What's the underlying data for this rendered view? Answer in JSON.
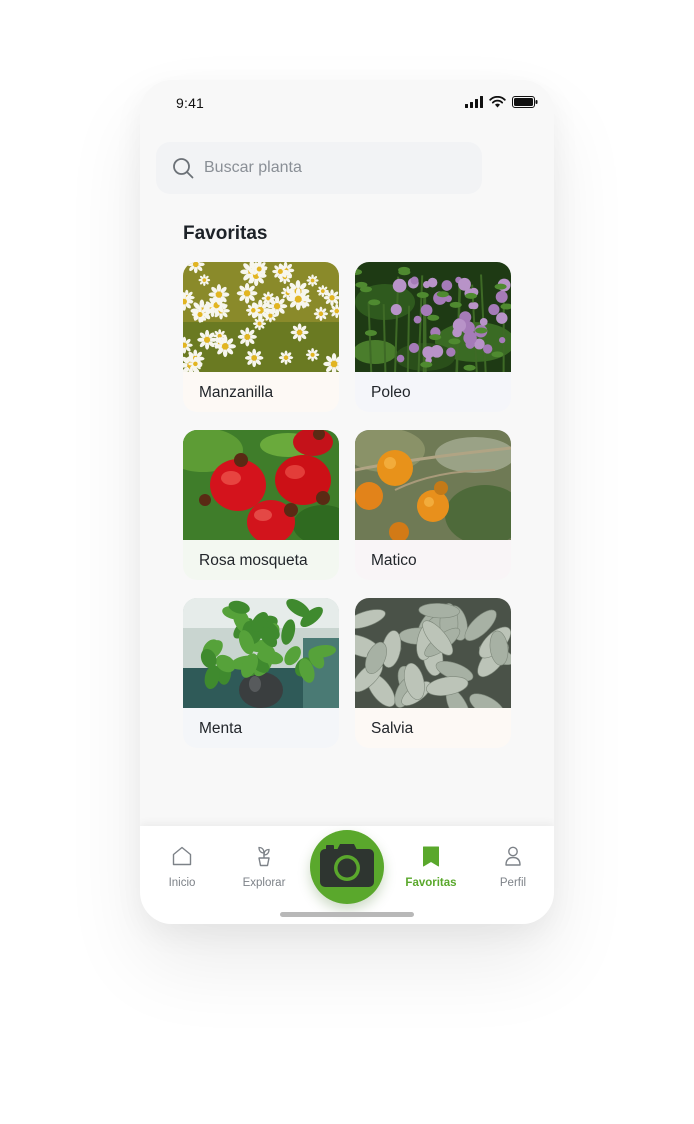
{
  "status_bar": {
    "time": "9:41"
  },
  "search": {
    "placeholder": "Buscar planta",
    "value": ""
  },
  "favorites": {
    "title": "Favoritas",
    "items": [
      {
        "name": "Manzanilla",
        "image": "chamomile-photo",
        "bg": "#fdf9f5"
      },
      {
        "name": "Poleo",
        "image": "pennyroyal-photo",
        "bg": "#f5f6fa"
      },
      {
        "name": "Rosa mosqueta",
        "image": "rosehip-photo",
        "bg": "#f3f8f1"
      },
      {
        "name": "Matico",
        "image": "matico-photo",
        "bg": "#f9f5f7"
      },
      {
        "name": "Menta",
        "image": "mint-photo",
        "bg": "#f4f6f9"
      },
      {
        "name": "Salvia",
        "image": "sage-photo",
        "bg": "#fdf9f5"
      }
    ]
  },
  "bottom_nav": {
    "items": [
      {
        "label": "Inicio",
        "icon": "home-icon",
        "active": false
      },
      {
        "label": "Explorar",
        "icon": "plant-pot-icon",
        "active": false
      },
      {
        "label": "Favoritas",
        "icon": "bookmark-icon",
        "active": true
      },
      {
        "label": "Perfil",
        "icon": "user-icon",
        "active": false
      }
    ],
    "camera_icon": "camera-icon"
  },
  "colors": {
    "accent": "#5aa82c",
    "text": "#1d2228",
    "muted": "#7d8288"
  }
}
